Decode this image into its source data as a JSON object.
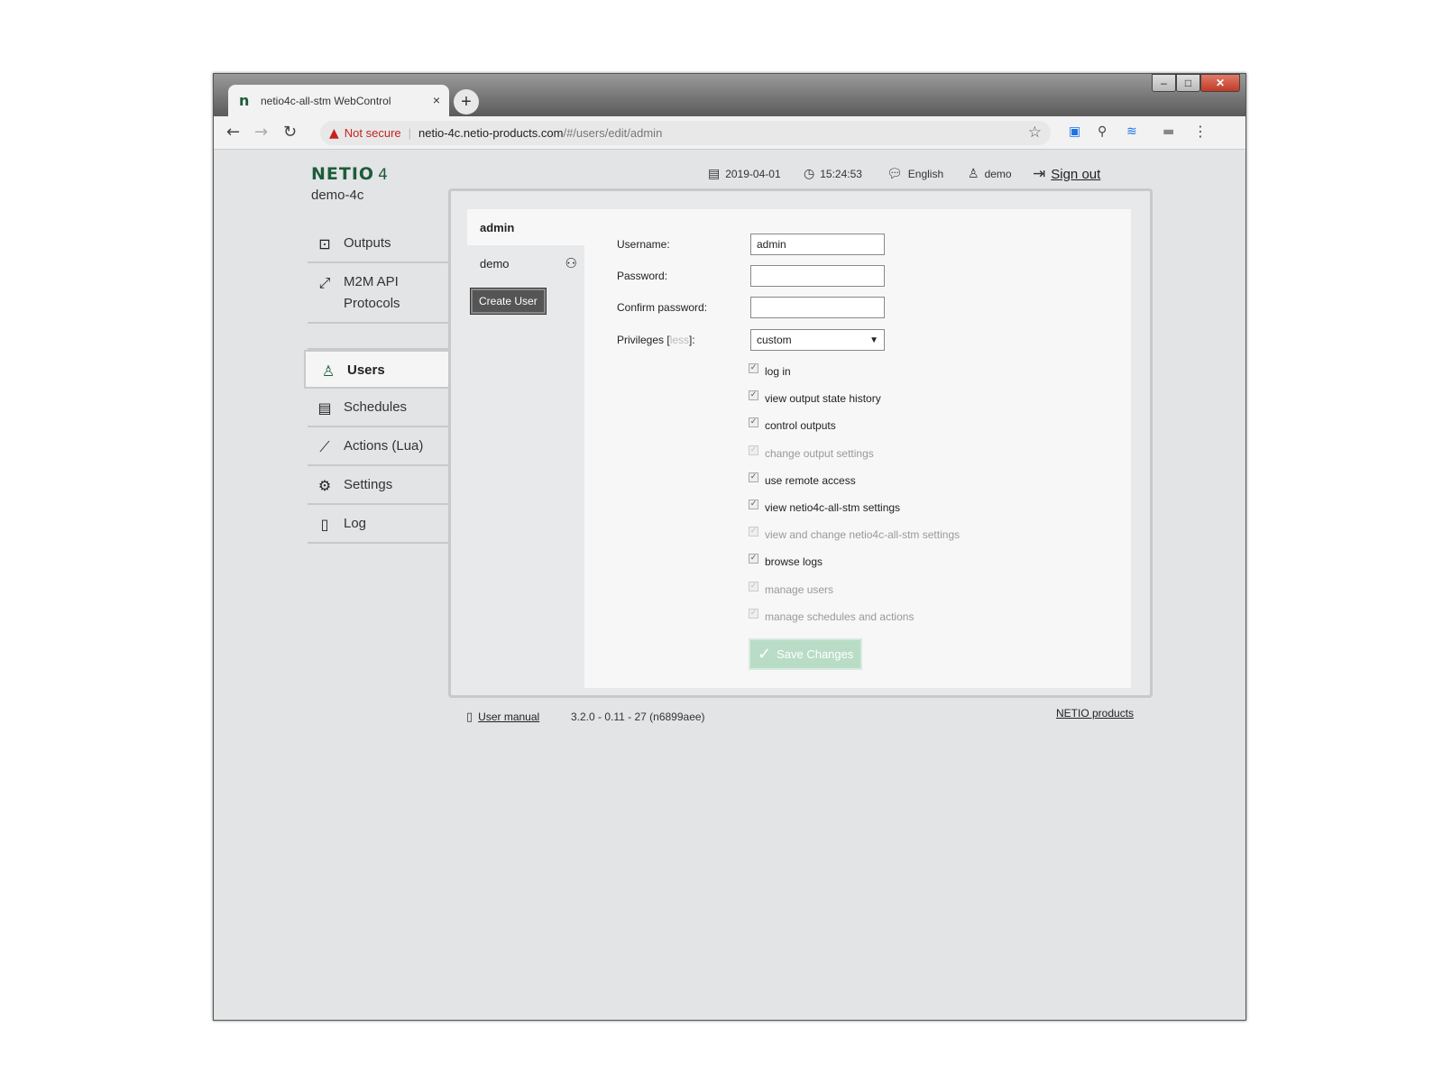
{
  "browser": {
    "tab_title": "netio4c-all-stm WebControl",
    "tab_close": "×",
    "new_tab": "+",
    "not_secure": "Not secure",
    "url_host": "netio-4c.netio-products.com",
    "url_path": "/#/users/edit/admin",
    "window_controls": [
      "–",
      "□",
      "✕"
    ],
    "icons": [
      "back-icon",
      "forward-icon",
      "reload-icon",
      "warning-icon",
      "star-icon",
      "menu-icon"
    ]
  },
  "header": {
    "logo": "NETIO",
    "logo_suffix": "4",
    "device_name": "demo-4c",
    "date": "2019-04-01",
    "time": "15:24:53",
    "language": "English",
    "user": "demo",
    "sign_out": "Sign out"
  },
  "sidebar": {
    "items": [
      {
        "label": "Outputs",
        "icon": "outputs-icon"
      },
      {
        "label": "M2M API Protocols",
        "icon": "m2m-icon"
      },
      {
        "label": "Users",
        "icon": "user-icon",
        "active": true
      },
      {
        "label": "Schedules",
        "icon": "calendar-icon"
      },
      {
        "label": "Actions (Lua)",
        "icon": "wand-icon"
      },
      {
        "label": "Settings",
        "icon": "gear-icon"
      },
      {
        "label": "Log",
        "icon": "document-icon"
      }
    ],
    "m2m_line1": "M2M API",
    "m2m_line2": "Protocols"
  },
  "users": {
    "list": [
      {
        "name": "admin",
        "active": true
      },
      {
        "name": "demo",
        "active": false
      }
    ],
    "create_button": "Create User"
  },
  "form": {
    "username_label": "Username:",
    "username_value": "admin",
    "password_label": "Password:",
    "confirm_label": "Confirm password:",
    "privileges_label_pre": "Privileges [",
    "privileges_less": "less",
    "privileges_label_post": "]:",
    "privileges_value": "custom",
    "permissions": [
      {
        "label": "log in",
        "checked": true,
        "disabled": false
      },
      {
        "label": "view output state history",
        "checked": true,
        "disabled": false
      },
      {
        "label": "control outputs",
        "checked": true,
        "disabled": false
      },
      {
        "label": "change output settings",
        "checked": true,
        "disabled": true
      },
      {
        "label": "use remote access",
        "checked": true,
        "disabled": false
      },
      {
        "label": "view netio4c-all-stm settings",
        "checked": true,
        "disabled": false
      },
      {
        "label": "view and change netio4c-all-stm settings",
        "checked": true,
        "disabled": true
      },
      {
        "label": "browse logs",
        "checked": true,
        "disabled": false
      },
      {
        "label": "manage users",
        "checked": true,
        "disabled": true
      },
      {
        "label": "manage schedules and actions",
        "checked": true,
        "disabled": true
      }
    ],
    "save_button": "Save Changes"
  },
  "footer": {
    "user_manual": "User manual",
    "version": "3.2.0 - 0.11 - 27 (n6899aee)",
    "netio_products": "NETIO products"
  },
  "colors": {
    "brand_green": "#1d5c3a",
    "save_disabled": "#b9dcc6",
    "page_bg": "#e3e4e5",
    "warning_red": "#c5221f"
  }
}
